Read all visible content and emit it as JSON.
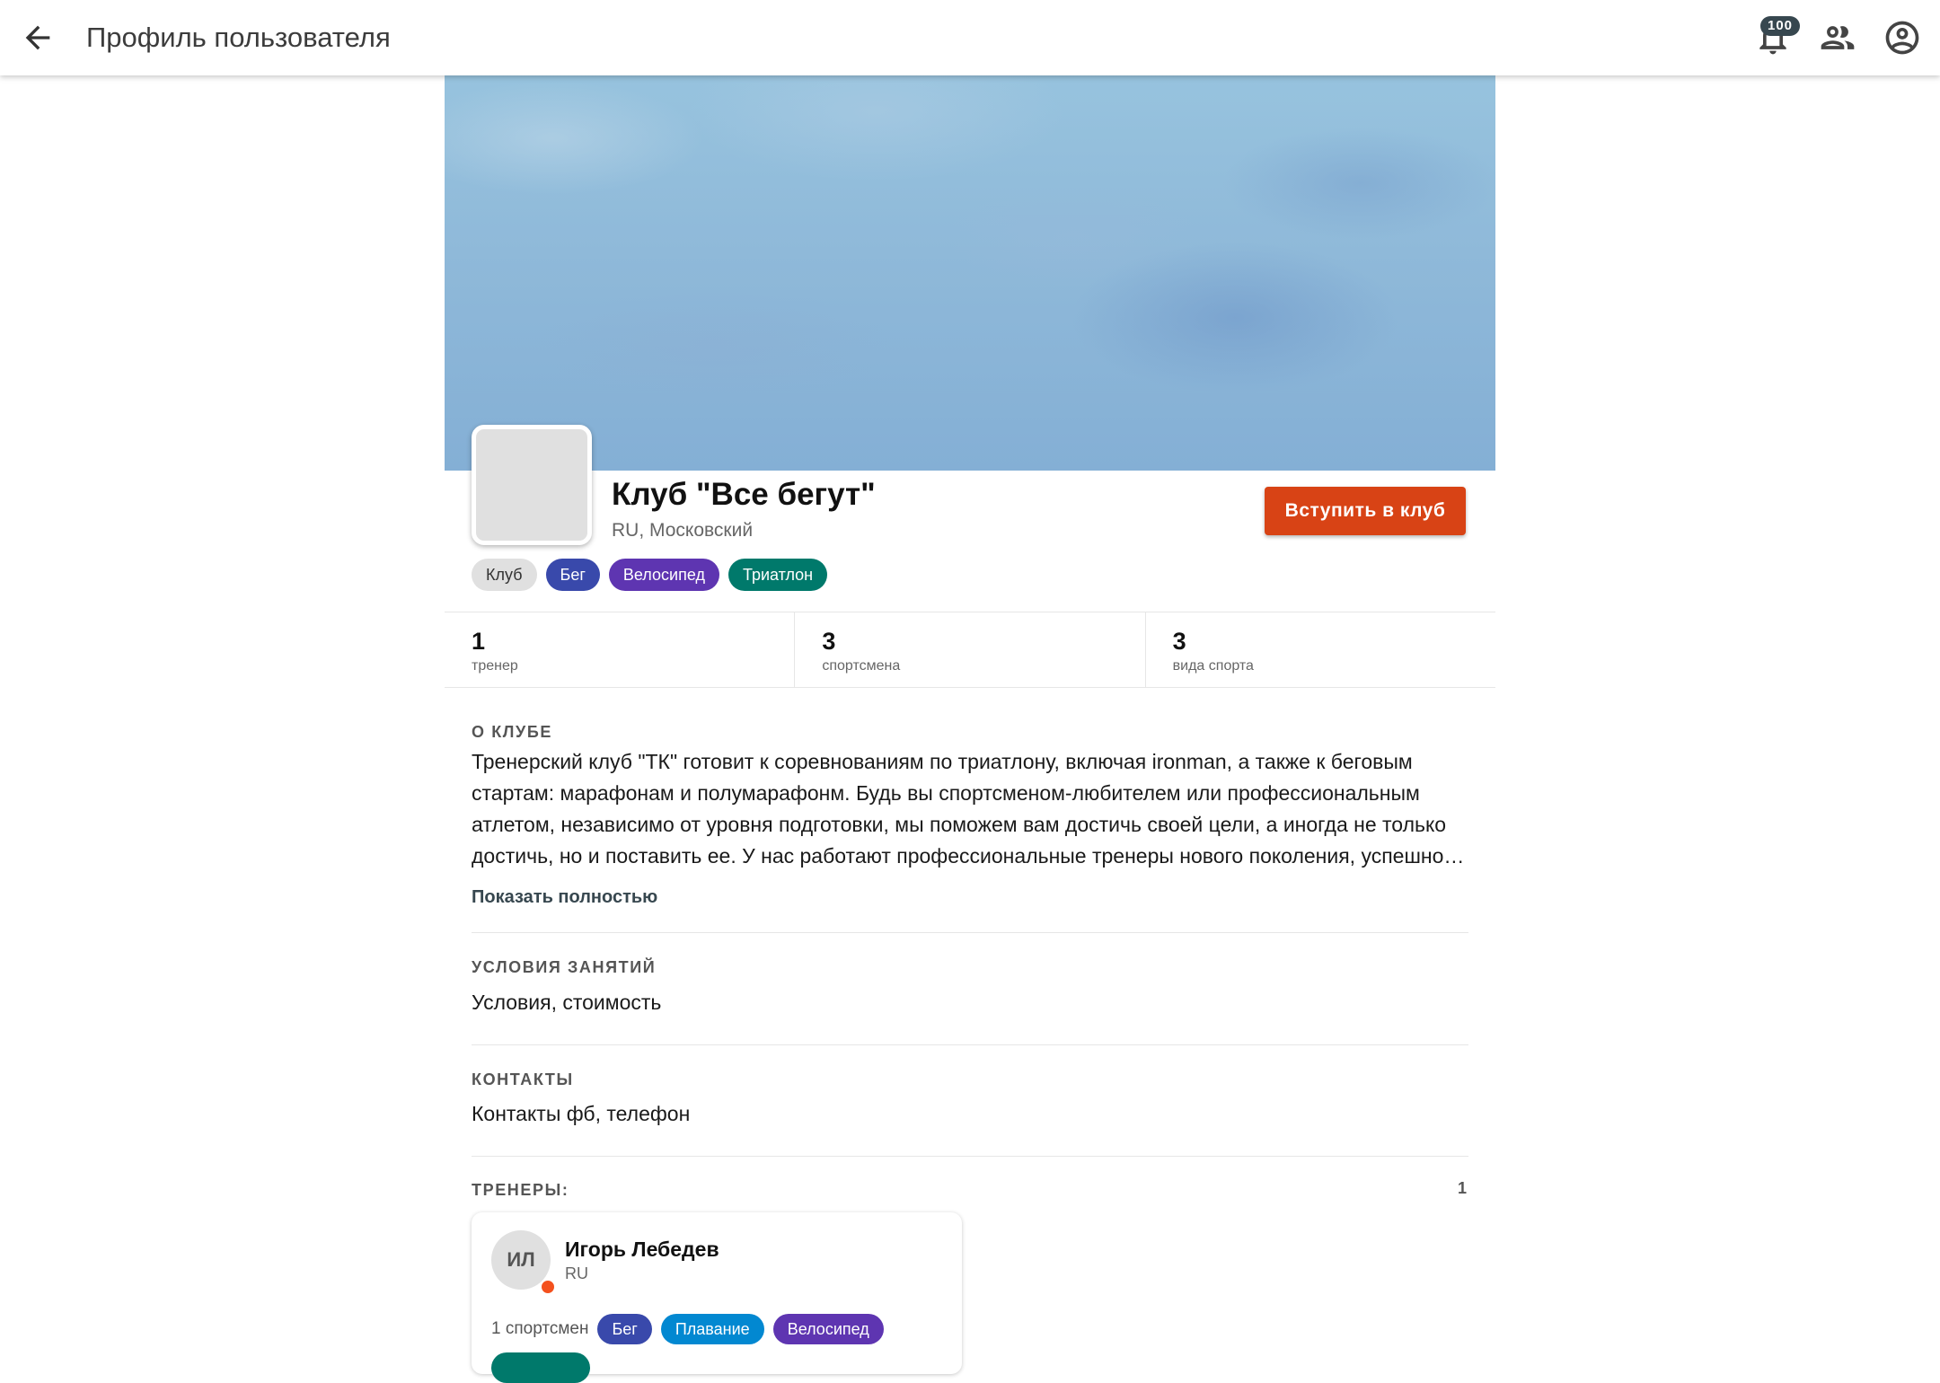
{
  "header": {
    "title": "Профиль пользователя",
    "notifications_count": "100"
  },
  "club": {
    "name": "Клуб \"Все бегут\"",
    "location": "RU, Московский",
    "join_label": "Вступить в клуб",
    "tags": [
      {
        "label": "Клуб",
        "color": "#e0e0e0"
      },
      {
        "label": "Бег",
        "color": "#3949ab"
      },
      {
        "label": "Велосипед",
        "color": "#5e35b1"
      },
      {
        "label": "Триатлон",
        "color": "#00796b"
      }
    ]
  },
  "stats": [
    {
      "value": "1",
      "label": "тренер"
    },
    {
      "value": "3",
      "label": "спортсмена"
    },
    {
      "value": "3",
      "label": "вида спорта"
    }
  ],
  "about": {
    "title": "О КЛУБЕ",
    "text": "Тренерский клуб \"ТК\" готовит к соревнованиям по триатлону, включая ironman, а также к беговым стартам: марафонам и полумарафонм. Будь вы спортсменом-любителем или профессиональным атлетом, независимо от уровня подготовки, мы поможем вам достичь своей цели, а иногда не только достичь, но и поставить ее. У нас работают профессиональные тренеры нового поколения, успешно…",
    "show_more": "Показать полностью"
  },
  "conditions": {
    "title": "УСЛОВИЯ ЗАНЯТИЙ",
    "text": "Условия, стоимость"
  },
  "contacts": {
    "title": "КОНТАКТЫ",
    "text": "Контакты фб, телефон"
  },
  "coaches": {
    "title": "ТРЕНЕРЫ:",
    "count": "1",
    "items": [
      {
        "initials": "ИЛ",
        "name": "Игорь Лебедев",
        "country": "RU",
        "athletes": "1 спортсмен",
        "sports": [
          {
            "label": "Бег",
            "color": "#3949ab"
          },
          {
            "label": "Плавание",
            "color": "#0288d1"
          },
          {
            "label": "Велосипед",
            "color": "#5e35b1"
          }
        ],
        "next_chip_color": "#00796b"
      }
    ]
  }
}
